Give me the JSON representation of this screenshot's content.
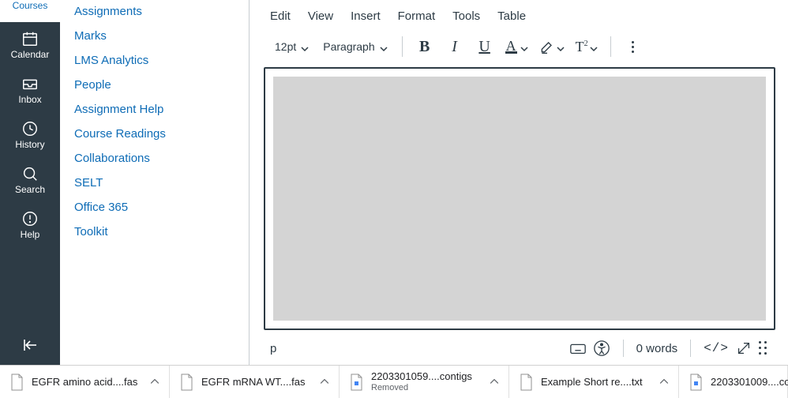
{
  "rail": {
    "courses": "Courses",
    "calendar": "Calendar",
    "inbox": "Inbox",
    "history": "History",
    "search": "Search",
    "help": "Help"
  },
  "course_nav": {
    "assignments": "Assignments",
    "marks": "Marks",
    "lms_analytics": "LMS Analytics",
    "people": "People",
    "assignment_help": "Assignment Help",
    "course_readings": "Course Readings",
    "collaborations": "Collaborations",
    "selt": "SELT",
    "office365": "Office 365",
    "toolkit": "Toolkit"
  },
  "editor": {
    "menubar": {
      "edit": "Edit",
      "view": "View",
      "insert": "Insert",
      "format": "Format",
      "tools": "Tools",
      "table": "Table"
    },
    "toolbar": {
      "font_size": "12pt",
      "block": "Paragraph"
    },
    "status": {
      "path": "p",
      "words": "0 words",
      "code": "</>"
    }
  },
  "downloads": {
    "items": [
      {
        "name": "EGFR amino acid....fas",
        "sub": ""
      },
      {
        "name": "EGFR mRNA WT....fas",
        "sub": ""
      },
      {
        "name": "2203301059....contigs",
        "sub": "Removed"
      },
      {
        "name": "Example Short re....txt",
        "sub": ""
      },
      {
        "name": "2203301009....co",
        "sub": ""
      }
    ]
  }
}
